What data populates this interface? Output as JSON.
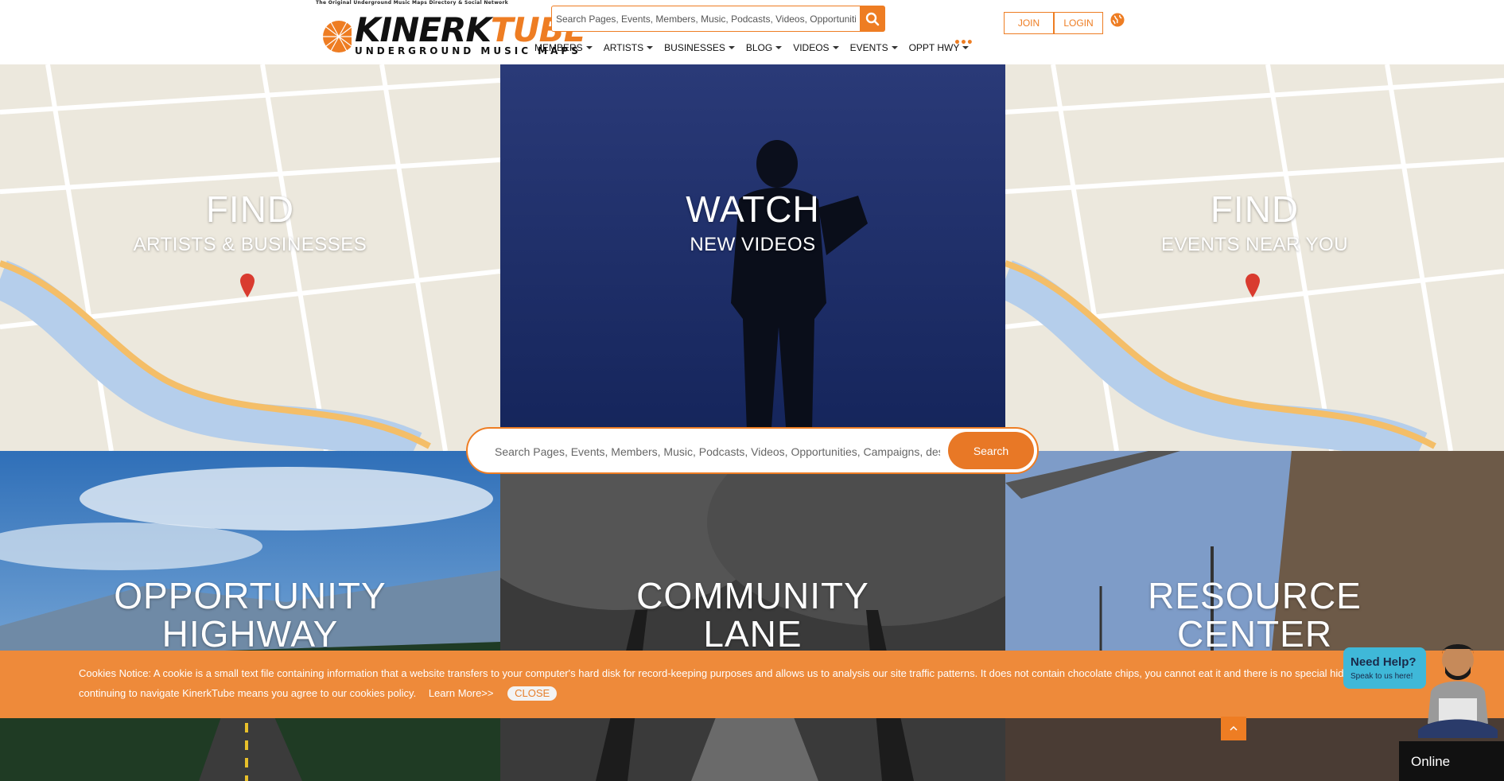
{
  "header": {
    "tagline": "The Original Underground Music Maps Directory & Social Network",
    "logo": {
      "wordmark": "KINERKTUBE",
      "subtitle": "UNDERGROUND MUSIC MAPS"
    },
    "search": {
      "placeholder": "Search Pages, Events, Members, Music, Podcasts, Videos, Opportunities"
    },
    "nav": [
      {
        "label": "MEMBERS"
      },
      {
        "label": "ARTISTS"
      },
      {
        "label": "BUSINESSES"
      },
      {
        "label": "BLOG"
      },
      {
        "label": "VIDEOS"
      },
      {
        "label": "EVENTS"
      },
      {
        "label": "OPPT HWY"
      }
    ],
    "more": "•••",
    "join_label": "JOIN",
    "login_label": "LOGIN"
  },
  "tiles": [
    {
      "title": "FIND",
      "subtitle": "ARTISTS & BUSINESSES"
    },
    {
      "title": "WATCH",
      "subtitle": "NEW VIDEOS"
    },
    {
      "title": "FIND",
      "subtitle": "EVENTS NEAR YOU"
    },
    {
      "line1": "OPPORTUNITY",
      "line2": "HIGHWAY"
    },
    {
      "line1": "COMMUNITY",
      "line2": "LANE"
    },
    {
      "line1": "RESOURCE",
      "line2": "CENTER"
    }
  ],
  "hero_search": {
    "placeholder": "Search Pages, Events, Members, Music, Podcasts, Videos, Opportunities, Campaigns, descriptions...",
    "button": "Search"
  },
  "cookie": {
    "text": "Cookies Notice: A cookie is a small text file containing information that a website transfers to your computer's hard disk for record-keeping purposes and allows us to analysis our site traffic patterns. It does not contain chocolate chips, you cannot eat it and there is no special hidden jar. By continuing to navigate KinerkTube means you agree to our cookies policy.",
    "learn_more": "Learn More>>",
    "close": "CLOSE"
  },
  "help": {
    "title": "Need Help?",
    "subtitle": "Speak to us here!",
    "status": "Online"
  },
  "colors": {
    "accent": "#ee7d23",
    "cookie_bar": "#ee8a3a",
    "help_bubble": "#3fb8d8"
  }
}
